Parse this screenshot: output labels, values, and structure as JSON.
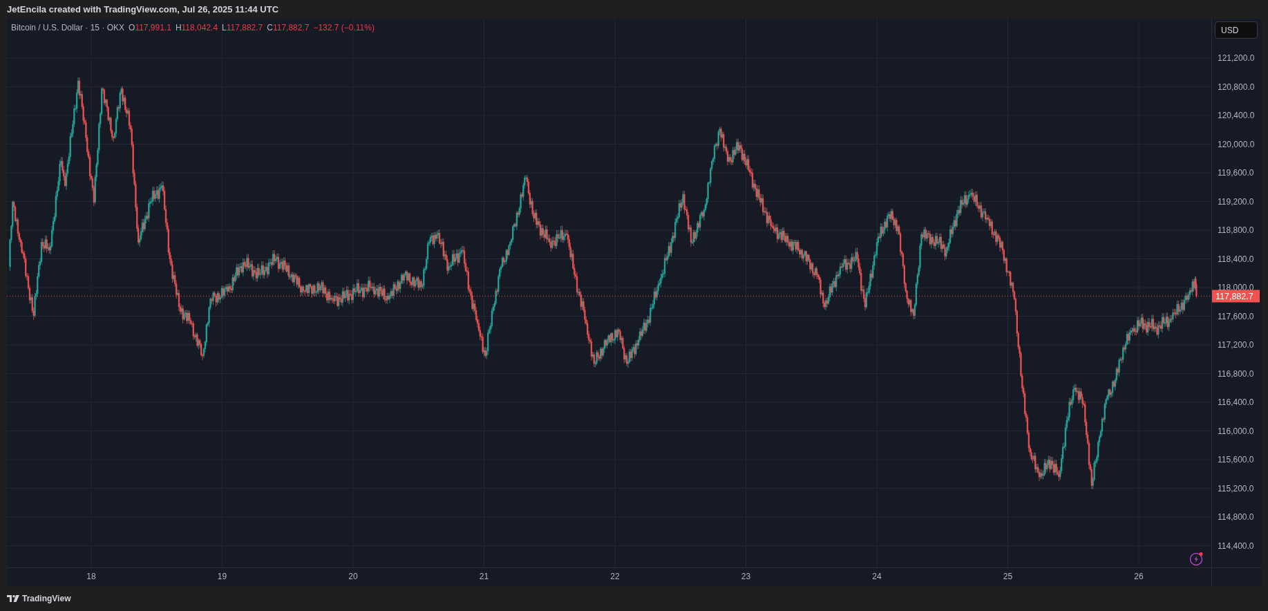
{
  "header": {
    "credit": "JetEncila created with TradingView.com, Jul 26, 2025 11:44 UTC"
  },
  "legend": {
    "symbol": "Bitcoin / U.S. Dollar · 15 · OKX",
    "ohlc": [
      {
        "label": "O",
        "value": "117,991.1"
      },
      {
        "label": "H",
        "value": "118,042.4"
      },
      {
        "label": "L",
        "value": "117,882.7"
      },
      {
        "label": "C",
        "value": "117,882.7"
      }
    ],
    "change": "−132.7 (−0.11%)"
  },
  "currency_button": "USD",
  "price_axis": {
    "labels": [
      "121,200.0",
      "120,800.0",
      "120,400.0",
      "120,000.0",
      "119,600.0",
      "119,200.0",
      "118,800.0",
      "118,400.0",
      "118,000.0",
      "117,600.0",
      "117,200.0",
      "116,800.0",
      "116,400.0",
      "116,000.0",
      "115,600.0",
      "115,200.0",
      "114,800.0",
      "114,400.0"
    ],
    "last_price": "117,882.7"
  },
  "time_axis": {
    "labels": [
      "18",
      "19",
      "20",
      "21",
      "22",
      "23",
      "24",
      "25",
      "26"
    ]
  },
  "footer": {
    "brand": "TradingView"
  }
}
